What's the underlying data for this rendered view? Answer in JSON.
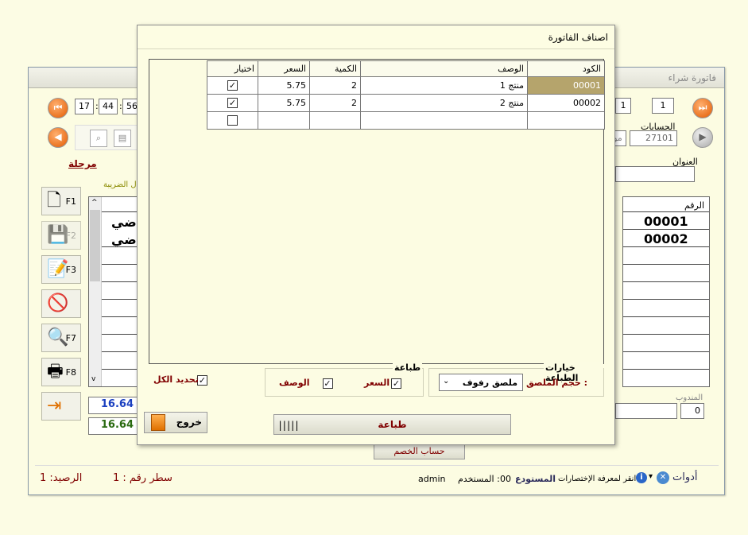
{
  "main_window": {
    "title": "فاتورة شراء",
    "time": {
      "hour": "17",
      "minute": "44",
      "second": "56"
    },
    "page_boxes": [
      "1",
      "1"
    ],
    "accounts_label": "الحسابات",
    "accounts_value": "27101",
    "accounts_partial": "مو",
    "stage_label": "مرحلة",
    "address_label": "العنوان",
    "tax_label": "ل الضريبة",
    "number_header": "الرقم",
    "row_codes": [
      "00001",
      "00002"
    ],
    "left_row_glyphs": [
      "ضي",
      "ضي"
    ],
    "total_1": "16.64",
    "total_2": "16.64",
    "rep_label": "المندوب",
    "rep_value": "0",
    "discount_button": "حساب الخصم",
    "toolbar_keys": [
      "F1",
      "F2",
      "F3",
      "F7",
      "F8"
    ]
  },
  "status_bar": {
    "tools_label": "أدوات",
    "shortcuts_hint": "انقر لمعرفة الإختصارات",
    "warehouse_label": "المستودع",
    "warehouse_value": "00",
    "user_label": "المستخدم :",
    "user_value": "admin",
    "line_label": "سطر رقم : 1",
    "balance_label": "الرصيد: 1"
  },
  "dialog": {
    "title": "اصناف الفاتورة",
    "columns": {
      "code": "الكود",
      "description": "الوصف",
      "quantity": "الكمية",
      "price": "السعر",
      "select": "اختيار"
    },
    "rows": [
      {
        "code": "00001",
        "description": "منتج 1",
        "quantity": "2",
        "price": "5.75",
        "selected": true
      },
      {
        "code": "00002",
        "description": "منتج 2",
        "quantity": "2",
        "price": "5.75",
        "selected": true
      },
      {
        "code": "",
        "description": "",
        "quantity": "",
        "price": "",
        "selected": false
      }
    ],
    "select_all_label": "تحديد الكل",
    "print_group": {
      "legend": "طباعة",
      "price_label": "السعر",
      "description_label": "الوصف"
    },
    "print_options": {
      "legend": "خيارات الطباعة",
      "label_size_label": "حجم الملصق :",
      "label_size_value": "ملصق رفوف"
    },
    "print_button": "طباعة",
    "exit_button": "خروج"
  },
  "colors": {
    "background": "#fcfce4",
    "selected_cell": "#b5a46c",
    "accent_red": "#800000",
    "total_blue": "#1a3fc0",
    "total_green": "#2a6a10"
  }
}
